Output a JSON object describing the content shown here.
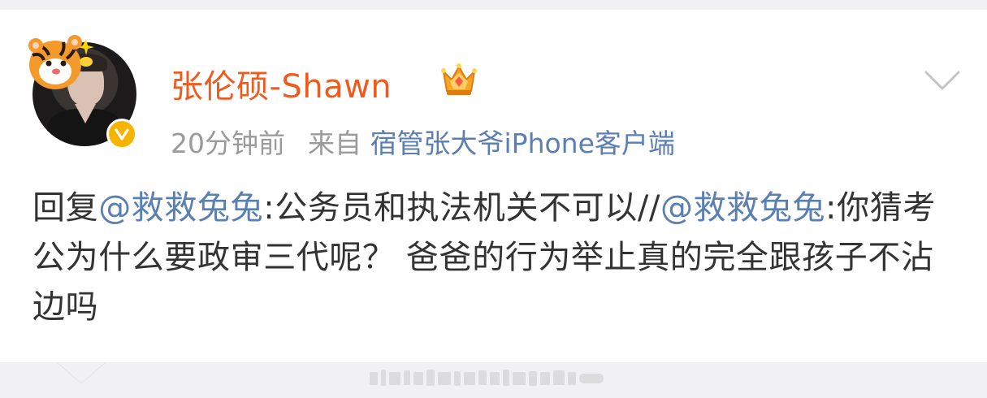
{
  "post": {
    "username": "张伦硕-Shawn",
    "timestamp": "20分钟前",
    "source_prefix": "来自",
    "source_client": "宿管张大爷iPhone客户端",
    "content_parts": [
      {
        "type": "text",
        "text": "回复"
      },
      {
        "type": "mention",
        "text": "@救救兔兔"
      },
      {
        "type": "text",
        "text": ":公务员和执法机关不可以//"
      },
      {
        "type": "mention",
        "text": "@救救兔兔"
      },
      {
        "type": "text",
        "text": ":你猜考公为什么要政审三代呢？ 爸爸的行为举止真的完全跟孩子不沾边吗"
      }
    ]
  },
  "icons": {
    "verify": "verified-badge-icon",
    "crown": "vip-crown-icon",
    "menu": "chevron-down-icon"
  },
  "colors": {
    "username": "#f15a1e",
    "link": "#5b7fb0",
    "meta": "#9a9a9a",
    "text": "#333333",
    "badge": "#f4b400"
  }
}
